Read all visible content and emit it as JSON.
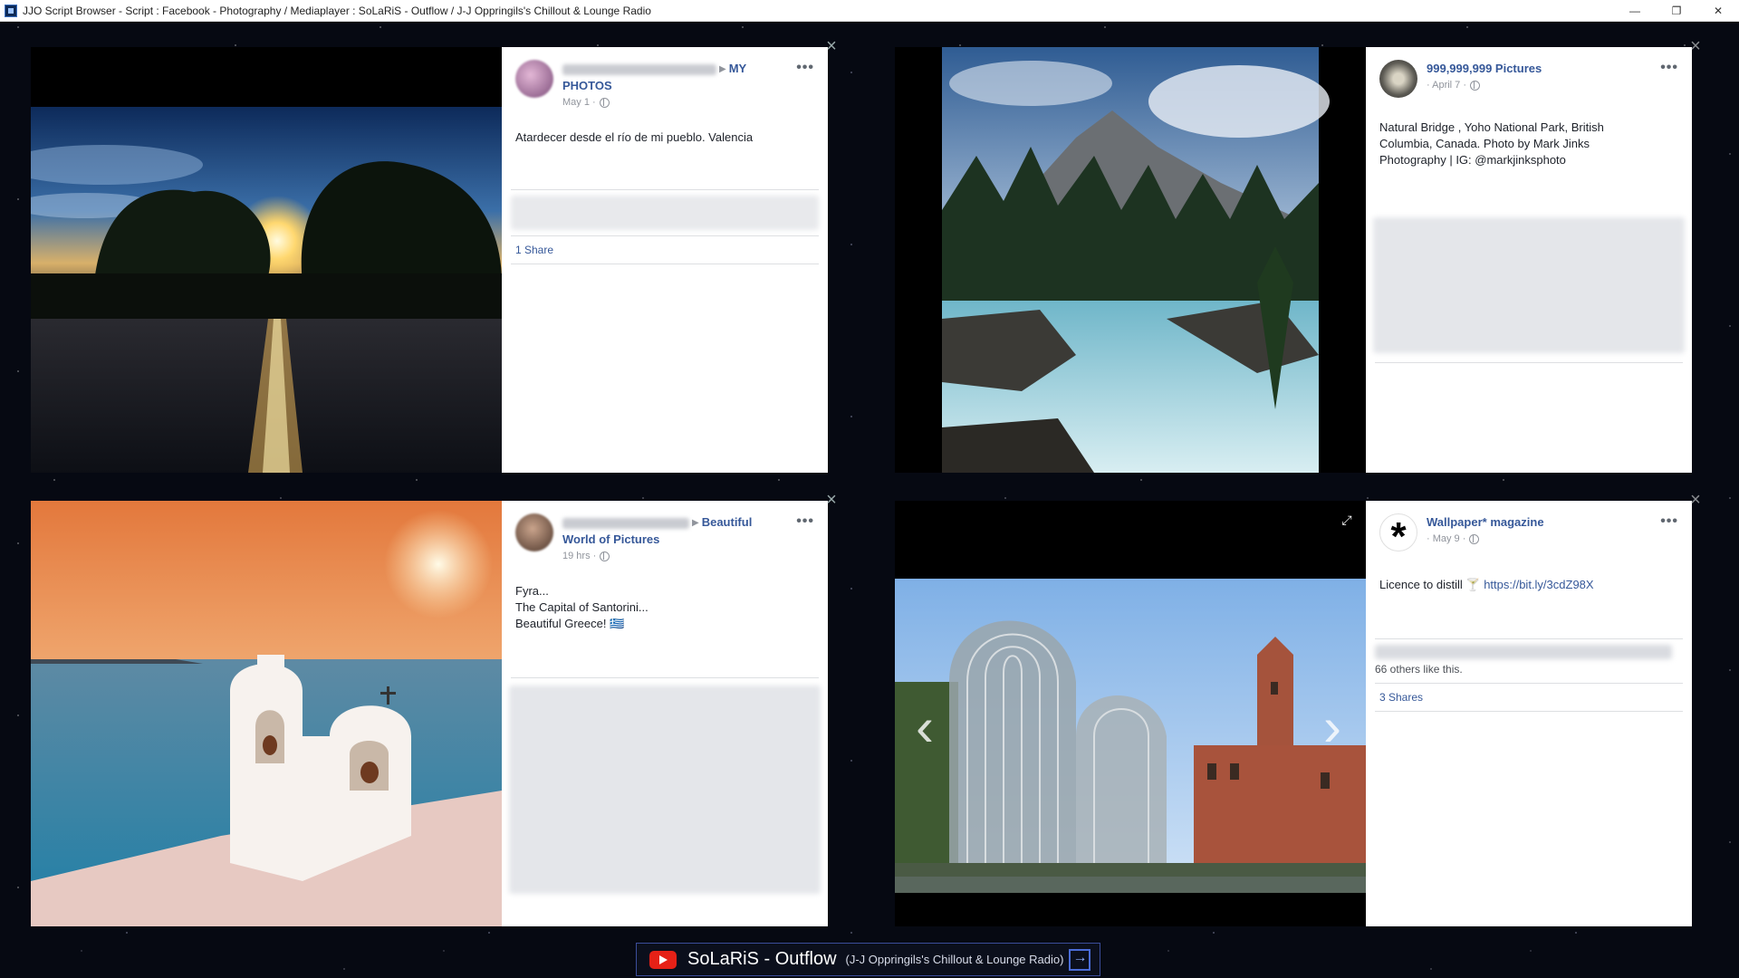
{
  "window": {
    "title": "JJO Script Browser - Script : Facebook - Photography / Mediaplayer : SoLaRiS - Outflow  / J-J Oppringils's Chillout & Lounge Radio",
    "minimize": "—",
    "restore": "❐",
    "close": "✕"
  },
  "panels": [
    {
      "page_name_line1": "MY",
      "page_name_line2": "PHOTOS",
      "date": "May 1 ·",
      "caption_lines": [
        "Atardecer desde el río de mi pueblo. Valencia"
      ],
      "shares": "1 Share",
      "more": "•••",
      "close": "×"
    },
    {
      "page_name": "999,999,999 Pictures",
      "date": "· April 7 ·",
      "caption_lines": [
        "Natural Bridge , Yoho National Park, British",
        "Columbia, Canada. Photo by Mark Jinks",
        "Photography | IG: @markjinksphoto"
      ],
      "more": "•••",
      "close": "×"
    },
    {
      "page_name_line1": "Beautiful",
      "page_name_line2": "World of Pictures",
      "date": "19 hrs ·",
      "caption_lines": [
        "Fyra...",
        "The Capital of Santorini...",
        "Beautiful Greece! 🇬🇷"
      ],
      "more": "•••",
      "close": "×"
    },
    {
      "page_name": "Wallpaper* magazine",
      "date": "· May 9 ·",
      "caption_prefix": "Licence to distill  🍸 ",
      "caption_link": "https://bit.ly/3cdZ98X",
      "likes": "66 others like this.",
      "shares": "3 Shares",
      "more": "•••",
      "close": "×",
      "expand": "⤢",
      "prev": "‹",
      "next": "›"
    }
  ],
  "player": {
    "title": "SoLaRiS - Outflow",
    "subtitle": "(J-J Oppringils's Chillout & Lounge Radio)"
  },
  "colors": {
    "link": "#365899",
    "youtube_red": "#e62117",
    "player_border": "#3b4d9a"
  }
}
